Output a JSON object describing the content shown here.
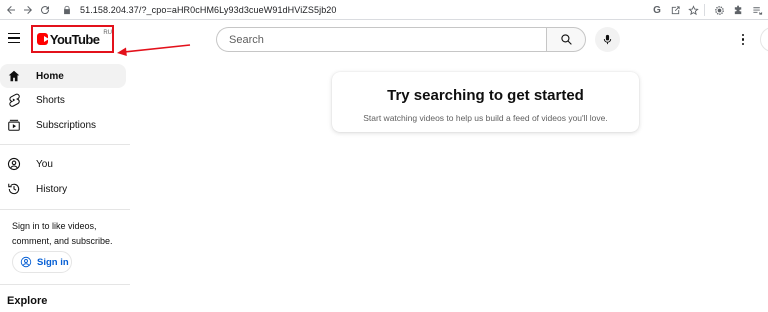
{
  "browser": {
    "url": "51.158.204.37/?_cpo=aHR0cHM6Ly93d3cueW91dHViZS5jb20",
    "back_icon": "arrow-left-icon",
    "forward_icon": "arrow-right-icon",
    "reload_icon": "reload-icon",
    "lock_icon": "lock-icon",
    "toolbar_icons": [
      "google-icon",
      "share-icon",
      "star-icon",
      "extension-settings-icon",
      "puzzle-icon",
      "reading-list-icon"
    ]
  },
  "masthead": {
    "logo_text": "YouTube",
    "region": "RU",
    "search_placeholder": "Search",
    "annotation_color": "#e3111b"
  },
  "sidebar": {
    "items": [
      {
        "label": "Home",
        "icon": "home-icon",
        "active": true
      },
      {
        "label": "Shorts",
        "icon": "shorts-icon",
        "active": false
      },
      {
        "label": "Subscriptions",
        "icon": "subscriptions-icon",
        "active": false
      },
      {
        "label": "You",
        "icon": "you-icon",
        "active": false
      },
      {
        "label": "History",
        "icon": "history-icon",
        "active": false
      }
    ],
    "signin_text": "Sign in to like videos, comment, and subscribe.",
    "signin_button": "Sign in",
    "explore_label": "Explore"
  },
  "main": {
    "title": "Try searching to get started",
    "subtitle": "Start watching videos to help us build a feed of videos you'll love."
  }
}
